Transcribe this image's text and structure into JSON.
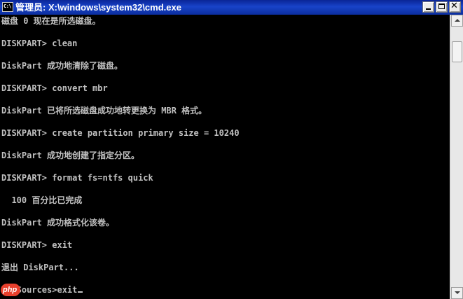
{
  "window": {
    "icon_text": "C:\\",
    "title": "管理员: X:\\windows\\system32\\cmd.exe",
    "buttons": {
      "minimize": "minimize-icon",
      "maximize": "maximize-icon",
      "close": "close-icon",
      "close_glyph": "✕"
    }
  },
  "console": {
    "lines": [
      "磁盘 0 现在是所选磁盘。",
      "",
      "DISKPART> clean",
      "",
      "DiskPart 成功地清除了磁盘。",
      "",
      "DISKPART> convert mbr",
      "",
      "DiskPart 已将所选磁盘成功地转更换为 MBR 格式。",
      "",
      "DISKPART> create partition primary size = 10240",
      "",
      "DiskPart 成功地创建了指定分区。",
      "",
      "DISKPART> format fs=ntfs quick",
      "",
      "  100 百分比已完成",
      "",
      "DiskPart 成功格式化该卷。",
      "",
      "DISKPART> exit",
      "",
      "退出 DiskPart...",
      "",
      "X:\\Sources>exit"
    ],
    "cursor": "_"
  },
  "scrollbar": {
    "up": "scroll-up-arrow-icon",
    "down": "scroll-down-arrow-icon"
  },
  "watermark": {
    "logo_text": "php"
  },
  "colors": {
    "console_bg": "#000000",
    "console_text": "#c0c0c0",
    "titlebar": "#1843c9"
  }
}
